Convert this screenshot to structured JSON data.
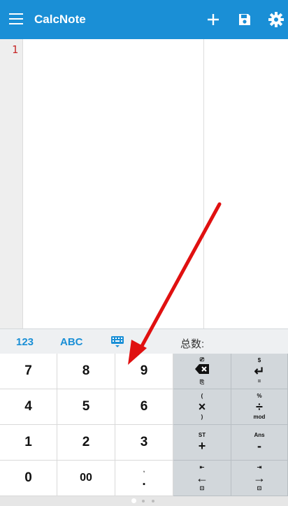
{
  "app": {
    "title": "CalcNote"
  },
  "editor": {
    "line_numbers": [
      "1"
    ]
  },
  "toolbar": {
    "tab_123": "123",
    "tab_abc": "ABC",
    "total_label": "总数:"
  },
  "keypad": {
    "digits": [
      {
        "label": "7"
      },
      {
        "label": "8"
      },
      {
        "label": "9"
      },
      {
        "label": "4"
      },
      {
        "label": "5"
      },
      {
        "label": "6"
      },
      {
        "label": "1"
      },
      {
        "label": "2"
      },
      {
        "label": "3"
      },
      {
        "label": "0"
      },
      {
        "label": "00"
      },
      {
        "label": ".",
        "sup": ","
      }
    ],
    "ops": [
      {
        "main": "⌫",
        "sup": "⎚",
        "sub": "⎘"
      },
      {
        "main": "↵",
        "sup": "$",
        "sub": "="
      },
      {
        "main": "×",
        "sup": "(",
        "sub": ")"
      },
      {
        "main": "÷",
        "sup": "%",
        "sub": "mod"
      },
      {
        "main": "+",
        "sup": "ST",
        "sub": ""
      },
      {
        "main": "-",
        "sup": "Ans",
        "sub": ""
      },
      {
        "main": "←",
        "sup": "⇤",
        "sub": "⊡"
      },
      {
        "main": "→",
        "sup": "⇥",
        "sub": "⊡"
      }
    ]
  },
  "colors": {
    "accent": "#1a8fd6",
    "arrow": "#e01010",
    "line_number": "#c62828"
  },
  "icons": {
    "menu": "hamburger-icon",
    "add": "plus-icon",
    "save": "save-icon",
    "settings": "gear-icon",
    "keyboard": "keyboard-icon"
  }
}
